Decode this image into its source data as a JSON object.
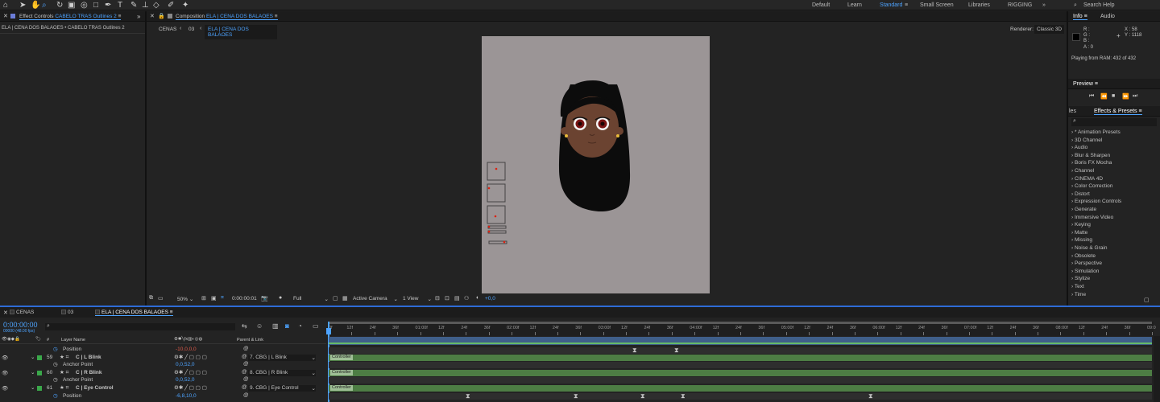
{
  "toolbar": {
    "workspaces": [
      "Default",
      "Learn",
      "Standard",
      "Small Screen",
      "Libraries",
      "RIGGING"
    ],
    "active_workspace": "Standard",
    "search_help": "Search Help"
  },
  "effect_controls": {
    "tab_label": "Effect Controls",
    "layer_name": "CABELO TRAS Outlines 2",
    "breadcrumb": "ELA | CENA DOS BALAOES • CABELO TRAS Outlines 2"
  },
  "composition": {
    "tab_label": "Composition",
    "comp_name": "ELA | CENA DOS BALAOES",
    "flow": [
      "CENAS",
      "03",
      "ELA | CENA DOS BALAOES"
    ],
    "renderer_label": "Renderer:",
    "renderer_value": "Classic 3D",
    "footer": {
      "zoom": "50%",
      "timecode": "0:00:00:01",
      "resolution": "Full",
      "camera": "Active Camera",
      "view": "1 View",
      "exposure": "+0,0"
    }
  },
  "info": {
    "tab": "Info",
    "tab2": "Audio",
    "r": "R :",
    "g": "G :",
    "b": "B :",
    "a": "A : 0",
    "x": "X : 58",
    "y": "Y : 1118",
    "status": "Playing from RAM: 432 of 432"
  },
  "preview": {
    "tab": "Preview"
  },
  "effects_presets": {
    "tab_prev": "les",
    "tab": "Effects & Presets",
    "items": [
      "* Animation Presets",
      "3D Channel",
      "Audio",
      "Blur & Sharpen",
      "Boris FX Mocha",
      "Channel",
      "CINEMA 4D",
      "Color Correction",
      "Distort",
      "Expression Controls",
      "Generate",
      "Immersive Video",
      "Keying",
      "Matte",
      "Missing",
      "Noise & Grain",
      "Obsolete",
      "Perspective",
      "Simulation",
      "Stylize",
      "Text",
      "Time"
    ]
  },
  "timeline": {
    "tabs": [
      "CENAS",
      "03",
      "ELA | CENA DOS BALAOES"
    ],
    "timecode": "0:00:00:00",
    "frame_info": "00000 (48.00 fps)",
    "col_num": "#",
    "col_layer": "Layer Name",
    "col_parent": "Parent & Link",
    "ruler": [
      "0f",
      "12f",
      "24f",
      "36f",
      "01:00f",
      "12f",
      "24f",
      "36f",
      "02:00f",
      "12f",
      "24f",
      "36f",
      "03:00f",
      "12f",
      "24f",
      "36f",
      "04:00f",
      "12f",
      "24f",
      "36f",
      "05:00f",
      "12f",
      "24f",
      "36f",
      "06:00f",
      "12f",
      "24f",
      "36f",
      "07:00f",
      "12f",
      "24f",
      "36f",
      "08:00f",
      "12f",
      "24f",
      "36f",
      "09:0"
    ],
    "rows": [
      {
        "kind": "prop",
        "name": "Position",
        "value": "-10,0,0,0",
        "value_color": "red"
      },
      {
        "kind": "layer",
        "num": "59",
        "name": "C | L Blink",
        "parent": "7. CBG | L Blink"
      },
      {
        "kind": "prop",
        "name": "Anchor Point",
        "value": "0,0,52,0",
        "value_color": "blue"
      },
      {
        "kind": "layer",
        "num": "60",
        "name": "C | R Blink",
        "parent": "8. CBG | R Blink"
      },
      {
        "kind": "prop",
        "name": "Anchor Point",
        "value": "0,0,52,0",
        "value_color": "blue"
      },
      {
        "kind": "layer",
        "num": "61",
        "name": "C | Eye Control",
        "parent": "9. CBG | Eye Control"
      },
      {
        "kind": "prop",
        "name": "Position",
        "value": "-6,8,10,0",
        "value_color": "blue"
      }
    ],
    "bar_label": "Controller"
  },
  "colors": {
    "accent": "#4da3ff",
    "bar": "#4d7d44",
    "comp_bg": "#9b9596",
    "layer_green": "#3aa84a"
  }
}
